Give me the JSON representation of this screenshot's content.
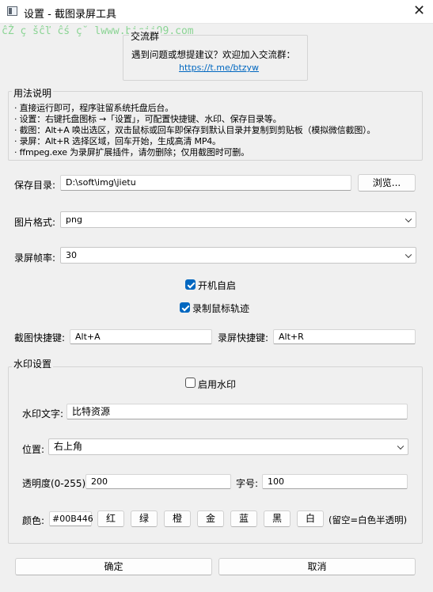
{
  "window": {
    "title": "设置 - 截图录屏工具"
  },
  "watermark": "ĉŽ ç šĉľ ĉś ç˘ lwww.bicji99.com",
  "group": {
    "title": "交流群",
    "prompt": "遇到问题或想提建议？欢迎加入交流群：",
    "link": "https://t.me/btzyw"
  },
  "usage": {
    "title": "用法说明",
    "lines": [
      "· 直接运行即可，程序驻留系统托盘后台。",
      "· 设置：右键托盘图标 →「设置」，可配置快捷键、水印、保存目录等。",
      "· 截图：Alt+A 唤出选区，双击鼠标或回车即保存到默认目录并复制到剪贴板（模拟微信截图）。",
      "· 录屏：Alt+R 选择区域，回车开始，生成高清 MP4。",
      "· ffmpeg.exe 为录屏扩展插件，请勿删除；仅用截图时可删。"
    ]
  },
  "save_dir": {
    "label": "保存目录:",
    "value": "D:\\soft\\img\\jietu",
    "browse": "浏览..."
  },
  "format": {
    "label": "图片格式:",
    "value": "png"
  },
  "fps": {
    "label": "录屏帧率:",
    "value": "30"
  },
  "autostart": {
    "label": "开机自启",
    "checked": true
  },
  "cursor": {
    "label": "录制鼠标轨迹",
    "checked": true
  },
  "hotkeys": {
    "shot_label": "截图快捷键:",
    "shot_value": "Alt+A",
    "rec_label": "录屏快捷键:",
    "rec_value": "Alt+R"
  },
  "watermark_settings": {
    "title": "水印设置",
    "enable_label": "启用水印",
    "enabled": false,
    "text_label": "水印文字:",
    "text_value": "比特资源",
    "position_label": "位置:",
    "position_value": "右上角",
    "opacity_label": "透明度(0-255):",
    "opacity_value": "200",
    "size_label": "字号:",
    "size_value": "100",
    "color_label": "颜色:",
    "color_value": "#00B446",
    "color_buttons": [
      "红",
      "绿",
      "橙",
      "金",
      "蓝",
      "黑",
      "白"
    ],
    "color_note": "(留空=白色半透明)"
  },
  "footer": {
    "ok": "确定",
    "cancel": "取消"
  },
  "colors": {
    "accent": "#0067c0",
    "watermark": "#7fd18a"
  }
}
